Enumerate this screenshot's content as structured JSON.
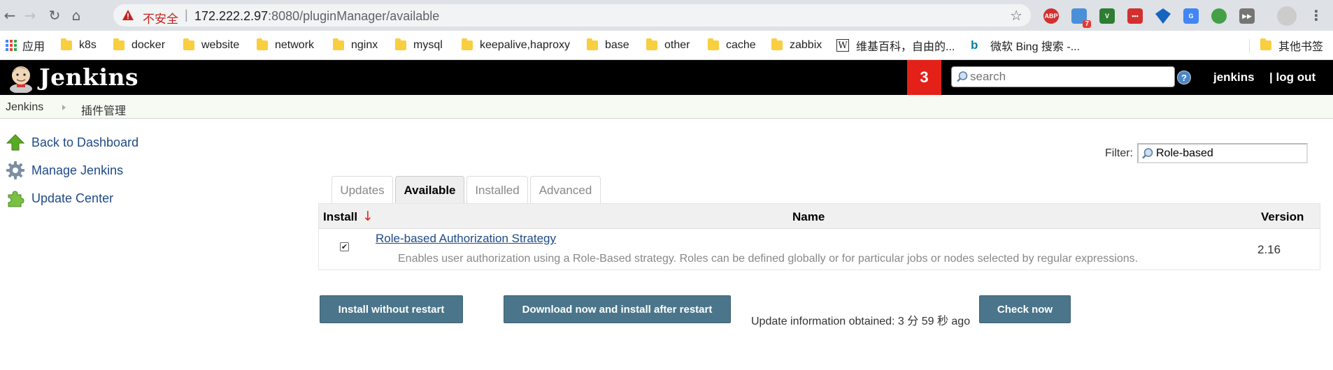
{
  "browser": {
    "security_label": "不安全",
    "url_host": "172.222.2.97",
    "url_rest": ":8080/pluginManager/available",
    "extension_badge": "7",
    "extension_labels": [
      "ABP",
      "V"
    ]
  },
  "bookmarks": {
    "apps": "应用",
    "items": [
      "k8s",
      "docker",
      "website",
      "network",
      "nginx",
      "mysql",
      "keepalive,haproxy",
      "base",
      "other",
      "cache",
      "zabbix"
    ],
    "wiki": "维基百科，自由的...",
    "bing": "微软 Bing 搜索 -...",
    "other_bookmarks": "其他书签"
  },
  "jenkins": {
    "title": "Jenkins",
    "badge_count": "3",
    "search_placeholder": "search",
    "help_glyph": "?",
    "user": "jenkins",
    "logout": "| log out"
  },
  "breadcrumb": {
    "items": [
      "Jenkins",
      "插件管理"
    ]
  },
  "sidepanel": {
    "tasks": [
      "Back to Dashboard",
      "Manage Jenkins",
      "Update Center"
    ]
  },
  "filter": {
    "label": "Filter:",
    "value": "Role-based"
  },
  "tabs": [
    "Updates",
    "Available",
    "Installed",
    "Advanced"
  ],
  "active_tab": "Available",
  "table": {
    "headers": {
      "install": "Install",
      "sort_arrow": "↓",
      "name": "Name",
      "version": "Version"
    },
    "rows": [
      {
        "checked": true,
        "name": "Role-based Authorization Strategy",
        "description": "Enables user authorization using a Role-Based strategy. Roles can be defined globally or for particular jobs or nodes selected by regular expressions.",
        "version": "2.16"
      }
    ]
  },
  "actions": {
    "install_without_restart": "Install without restart",
    "download_install_after_restart": "Download now and install after restart",
    "update_info": "Update information obtained: 3 分 59 秒 ago",
    "check_now": "Check now"
  },
  "colors": {
    "header_bg": "#000000",
    "badge_red": "#e32119",
    "button_blue": "#4b758b",
    "link_blue": "#204a87"
  }
}
